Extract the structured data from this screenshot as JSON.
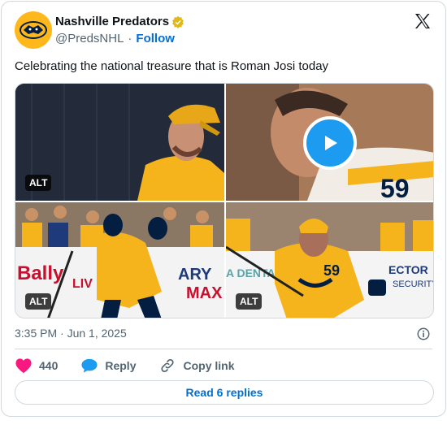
{
  "account": {
    "name": "Nashville Predators",
    "handle": "@PredsNHL",
    "separator": "·",
    "follow_label": "Follow",
    "avatar_icon": "predators-logo-icon",
    "verified_icon": "verified-badge-icon",
    "brand_color": "#ffb81c"
  },
  "platform_icon": "x-logo-icon",
  "tweet": {
    "text": "Celebrating the national treasure that is Roman Josi today"
  },
  "media": [
    {
      "kind": "photo",
      "description_icon": "player-smiling-photo",
      "alt_label": "ALT",
      "show_alt": true
    },
    {
      "kind": "video",
      "description_icon": "player-close-up-video",
      "play_icon": "play-icon",
      "show_alt": false
    },
    {
      "kind": "photo",
      "description_icon": "players-celebrating-photo",
      "alt_label": "ALT",
      "show_alt": true
    },
    {
      "kind": "photo",
      "description_icon": "player-skating-photo",
      "alt_label": "ALT",
      "show_alt": true
    }
  ],
  "meta": {
    "timestamp": "3:35 PM · Jun 1, 2025",
    "info_icon": "info-icon"
  },
  "actions": {
    "like_icon": "heart-icon",
    "like_count": "440",
    "reply_icon": "reply-bubble-icon",
    "reply_label": "Reply",
    "copy_icon": "link-icon",
    "copy_label": "Copy link"
  },
  "read_replies_label": "Read 6 replies",
  "colors": {
    "link": "#006fd6",
    "heart": "#f91880",
    "reply": "#1d9bf0",
    "muted": "#536471",
    "border": "#cfd9de"
  }
}
